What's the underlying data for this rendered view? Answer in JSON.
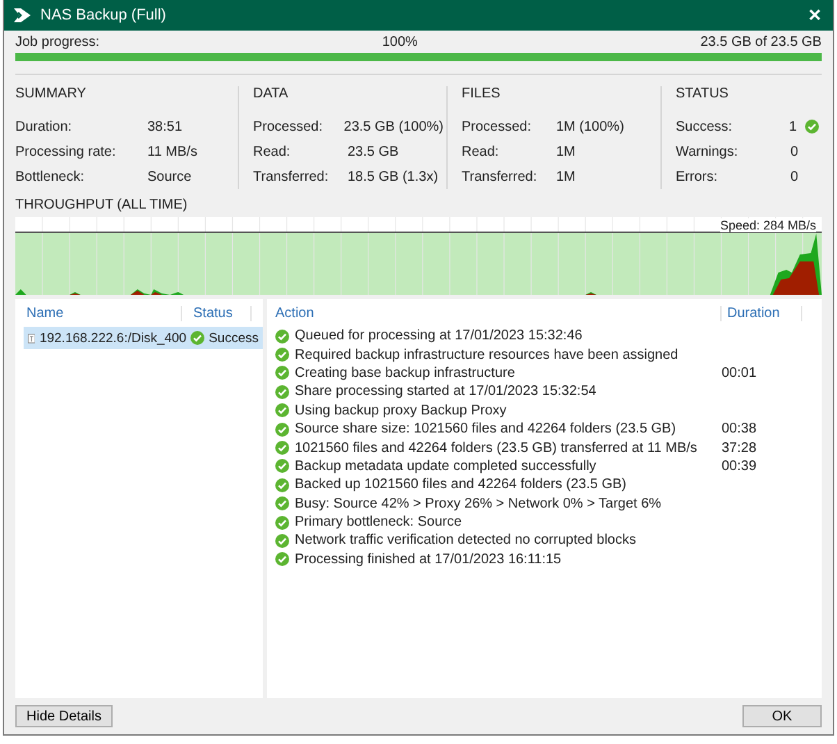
{
  "window": {
    "title": "NAS Backup (Full)",
    "close": "✕"
  },
  "progress": {
    "label": "Job progress:",
    "percent": "100%",
    "amount": "23.5 GB of 23.5 GB",
    "level": 1
  },
  "stats": [
    {
      "title": "SUMMARY",
      "rows": [
        {
          "label": "Duration:",
          "value": "38:51"
        },
        {
          "label": "Processing rate:",
          "value": "11 MB/s"
        },
        {
          "label": "Bottleneck:",
          "value": "Source"
        }
      ]
    },
    {
      "title": "DATA",
      "rows": [
        {
          "label": "Processed:",
          "value": "23.5 GB (100%)"
        },
        {
          "label": "Read:",
          "value": "23.5 GB"
        },
        {
          "label": "Transferred:",
          "value": "18.5 GB (1.3x)"
        }
      ]
    },
    {
      "title": "FILES",
      "rows": [
        {
          "label": "Processed:",
          "value": "1M (100%)"
        },
        {
          "label": "Read:",
          "value": "1M"
        },
        {
          "label": "Transferred:",
          "value": "1M"
        }
      ]
    },
    {
      "title": "STATUS",
      "rows": [
        {
          "label": "Success:",
          "value": "1",
          "ok": true
        },
        {
          "label": "Warnings:",
          "value": "0"
        },
        {
          "label": "Errors:",
          "value": "0"
        }
      ]
    }
  ],
  "throughput": {
    "title": "THROUGHPUT (ALL TIME)",
    "speed": "Speed: 284 MB/s"
  },
  "objects": {
    "columns": [
      "Name",
      "Status"
    ],
    "rows": [
      {
        "name": "192.168.222.6:/Disk_400",
        "status": "Success",
        "selected": true
      }
    ]
  },
  "actions": {
    "columns": [
      "Action",
      "Duration"
    ],
    "rows": [
      {
        "action": "Queued for processing at 17/01/2023 15:32:46"
      },
      {
        "action": "Required backup infrastructure resources have been assigned"
      },
      {
        "action": "Creating base backup infrastructure",
        "duration": "00:01"
      },
      {
        "action": "Share processing started at 17/01/2023 15:32:54"
      },
      {
        "action": "Using backup proxy Backup Proxy"
      },
      {
        "action": "Source share size: 1021560 files and 42264 folders (23.5 GB)",
        "duration": "00:38"
      },
      {
        "action": "1021560 files and 42264 folders (23.5 GB) transferred at 11 MB/s",
        "duration": "37:28"
      },
      {
        "action": "Backup metadata update completed successfully",
        "duration": "00:39"
      },
      {
        "action": "Backed up 1021560 files and 42264 folders (23.5 GB)"
      },
      {
        "action": "Busy: Source 42% > Proxy 26% > Network 0% > Target 6%"
      },
      {
        "action": "Primary bottleneck: Source"
      },
      {
        "action": "Network traffic verification detected no corrupted blocks"
      },
      {
        "action": "Processing finished at 17/01/2023 16:11:15"
      }
    ]
  },
  "buttons": {
    "left": "Hide Details",
    "right": "OK"
  }
}
